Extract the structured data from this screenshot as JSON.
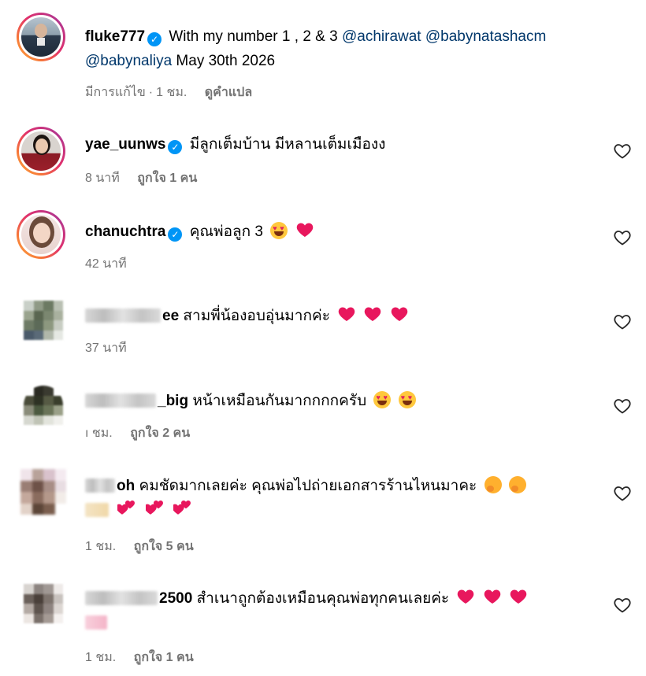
{
  "post": {
    "username": "fluke777",
    "caption_text": "With my number 1 , 2 & 3",
    "mentions": [
      "@achirawat",
      "@babynatashacm",
      "@babynaliya"
    ],
    "date_text": "May 30th 2026",
    "edited": "มีการแก้ไข",
    "separator": "·",
    "time": "1 ชม.",
    "translate": "ดูคำแปล"
  },
  "comments": [
    {
      "username": "yae_uunws",
      "verified": true,
      "text": "มีลูกเต็มบ้าน มีหลานเต็มเมืองง",
      "time": "8 นาที",
      "likes": "ถูกใจ 1 คน"
    },
    {
      "username": "chanuchtra",
      "verified": true,
      "text": "คุณพ่อลูก 3",
      "emojis": [
        "heart-eyes-emoji",
        "heart-emoji"
      ],
      "time": "42 นาที",
      "likes": ""
    },
    {
      "username_visible": "ee",
      "text": "สามพี่น้องอบอุ่นมากค่ะ",
      "emojis": [
        "heart-emoji",
        "heart-emoji",
        "heart-emoji"
      ],
      "time": "37 นาที",
      "likes": ""
    },
    {
      "username_visible": "_big",
      "text": "หน้าเหมือนกันมากกกกครับ",
      "emojis": [
        "heart-eyes-emoji",
        "heart-eyes-emoji"
      ],
      "time": "ı ชม.",
      "likes": "ถูกใจ 2 คน"
    },
    {
      "username_visible": "oh",
      "text": "คมชัดมากเลยค่ะ คุณพ่อไปถ่ายเอกสารร้านไหนมาคะ",
      "emojis": [
        "hugging-emoji",
        "hugging-emoji",
        "two-hearts-emoji",
        "two-hearts-emoji",
        "two-hearts-emoji"
      ],
      "time": "1 ชม.",
      "likes": "ถูกใจ 5 คน"
    },
    {
      "username_visible": "2500",
      "text": "สำเนาถูกต้องเหมือนคุณพ่อทุกคนเลยค่ะ",
      "emojis": [
        "heart-emoji",
        "heart-emoji",
        "heart-emoji"
      ],
      "time": "1 ชม.",
      "likes": "ถูกใจ 1 คน"
    }
  ],
  "colors": {
    "link": "#00376b",
    "verified": "#0095f6",
    "meta": "#737373",
    "heart": "#e8175d"
  }
}
